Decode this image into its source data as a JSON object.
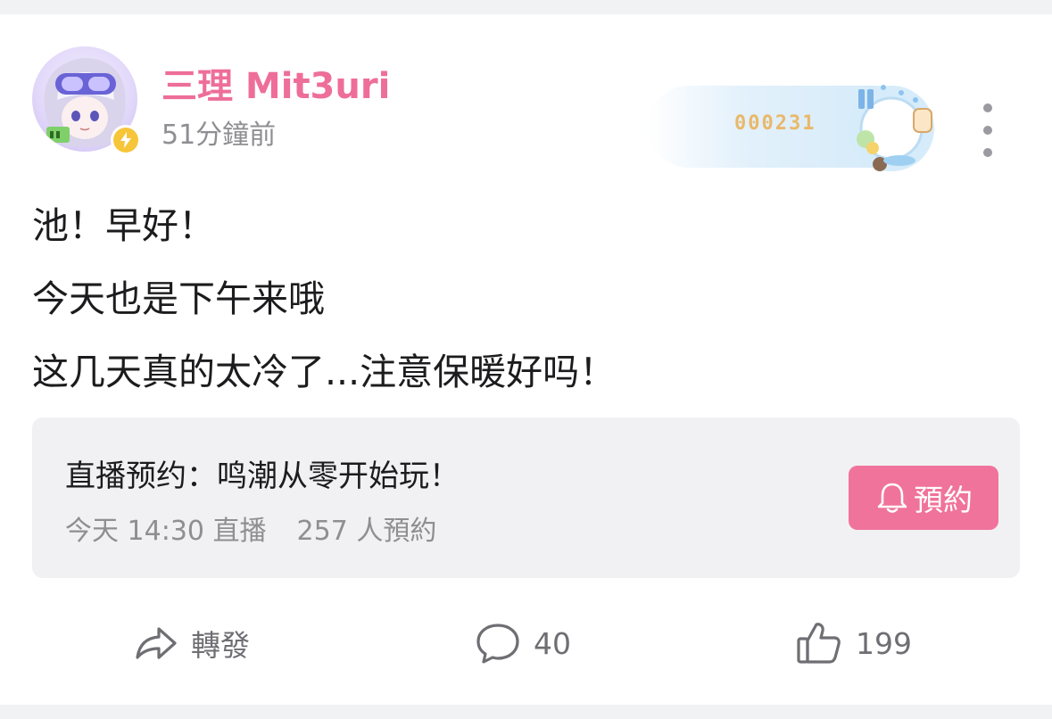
{
  "post": {
    "author": {
      "name": "三理 Mit3uri",
      "name_color": "#ee6e9a",
      "avatar_icon": "anime-character-avatar",
      "badge_icon": "lightning-icon",
      "badge_color": "#f7c53a"
    },
    "timestamp": "51分鐘前",
    "fan_badge": {
      "number": "000231",
      "emblem_icon": "decorative-emblem"
    },
    "more_icon": "vertical-ellipsis-icon",
    "body_lines": [
      "池！早好！",
      "今天也是下午来哦",
      "这几天真的太冷了...注意保暖好吗！"
    ],
    "live_reservation": {
      "title": "直播预约：鸣潮从零开始玩！",
      "time_text": "今天 14:30 直播",
      "count_text": "257 人預約",
      "button_label": "預約",
      "button_icon": "bell-icon",
      "button_color": "#f0739b"
    },
    "actions": {
      "share_label": "轉發",
      "share_icon": "share-arrow-icon",
      "comment_count": "40",
      "comment_icon": "comment-bubble-icon",
      "like_count": "199",
      "like_icon": "thumbs-up-icon"
    }
  }
}
